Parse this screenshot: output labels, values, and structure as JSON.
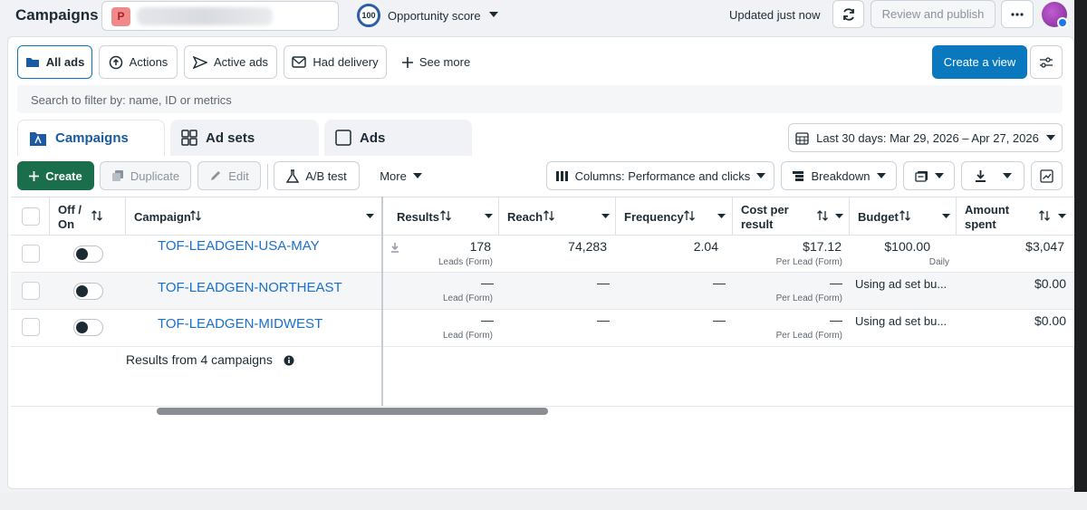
{
  "topbar": {
    "title": "Campaigns",
    "account_initial": "P",
    "opportunity_score": "100",
    "opportunity_label": "Opportunity score",
    "updated": "Updated just now",
    "review_label": "Review and publish"
  },
  "filters": {
    "all_ads": "All ads",
    "actions": "Actions",
    "active_ads": "Active ads",
    "had_delivery": "Had delivery",
    "see_more": "See more",
    "create_view": "Create a view"
  },
  "search": {
    "placeholder": "Search to filter by: name, ID or metrics"
  },
  "tabs": [
    {
      "label": "Campaigns"
    },
    {
      "label": "Ad sets"
    },
    {
      "label": "Ads"
    }
  ],
  "date_range": "Last 30 days: Mar 29, 2026 – Apr 27, 2026",
  "toolbar": {
    "create": "Create",
    "duplicate": "Duplicate",
    "edit": "Edit",
    "ab_test": "A/B test",
    "more": "More",
    "columns": "Columns: Performance and clicks",
    "breakdown": "Breakdown"
  },
  "columns": {
    "off_on_1": "Off /",
    "off_on_2": "On",
    "campaign": "Campaign",
    "results": "Results",
    "reach": "Reach",
    "frequency": "Frequency",
    "cost_1": "Cost per",
    "cost_2": "result",
    "budget": "Budget",
    "amount_1": "Amount",
    "amount_2": "spent"
  },
  "rows": [
    {
      "name": "TOF-LEADGEN-USA-MAY",
      "results": "178",
      "results_sub": "Leads (Form)",
      "reach": "74,283",
      "frequency": "2.04",
      "cost": "$17.12",
      "cost_sub": "Per Lead (Form)",
      "budget": "$100.00",
      "budget_sub": "Daily",
      "spent": "$3,047"
    },
    {
      "name": "TOF-LEADGEN-NORTHEAST",
      "results": "—",
      "results_sub": "Lead (Form)",
      "reach": "—",
      "frequency": "—",
      "cost": "—",
      "cost_sub": "Per Lead (Form)",
      "budget": "Using ad set bu...",
      "spent": "$0.00"
    },
    {
      "name": "TOF-LEADGEN-MIDWEST",
      "results": "—",
      "results_sub": "Lead (Form)",
      "reach": "—",
      "frequency": "—",
      "cost": "—",
      "cost_sub": "Per Lead (Form)",
      "budget": "Using ad set bu...",
      "spent": "$0.00"
    }
  ],
  "summary": "Results from 4 campaigns",
  "colors": {
    "accent": "#0a78be",
    "create_green": "#1a6e4b",
    "link": "#1a6fc9"
  }
}
